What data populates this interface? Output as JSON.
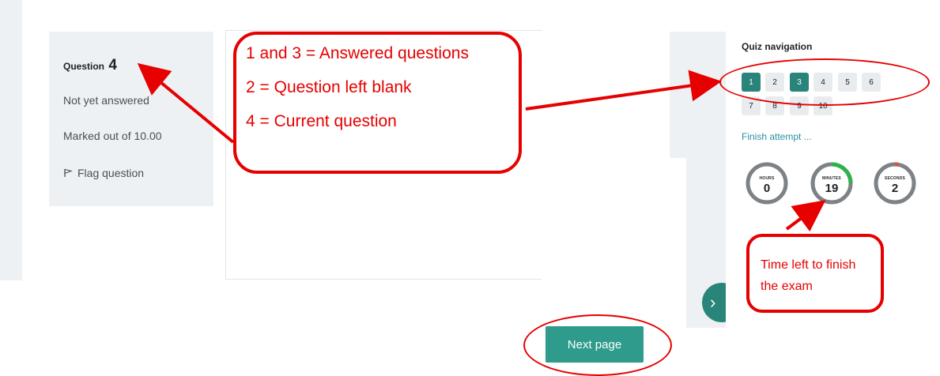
{
  "question": {
    "label": "Question",
    "number": "4",
    "status": "Not yet answered",
    "marks": "Marked out of 10.00",
    "flag_label": "Flag question"
  },
  "nav": {
    "title": "Quiz navigation",
    "buttons": [
      {
        "label": "1",
        "state": "answered"
      },
      {
        "label": "2",
        "state": "blank"
      },
      {
        "label": "3",
        "state": "answered"
      },
      {
        "label": "4",
        "state": "current"
      },
      {
        "label": "5",
        "state": "blank"
      },
      {
        "label": "6",
        "state": "blank"
      },
      {
        "label": "7",
        "state": "blank"
      },
      {
        "label": "8",
        "state": "blank"
      },
      {
        "label": "9",
        "state": "blank"
      },
      {
        "label": "10",
        "state": "blank"
      }
    ],
    "finish": "Finish attempt ..."
  },
  "timer": {
    "hours_label": "HOURS",
    "hours": "0",
    "minutes_label": "MINUTES",
    "minutes": "19",
    "seconds_label": "SECONDS",
    "seconds": "2"
  },
  "next_button": "Next page",
  "annotations": {
    "line1": "1 and 3 = Answered questions",
    "line2": "2 = Question left blank",
    "line3": "4 = Current question",
    "time_line1": "Time left to finish",
    "time_line2": "the exam"
  },
  "colors": {
    "answered": "#29857a",
    "blank": "#e9ecef",
    "annotation": "#e60000",
    "link": "#2a90a5"
  }
}
